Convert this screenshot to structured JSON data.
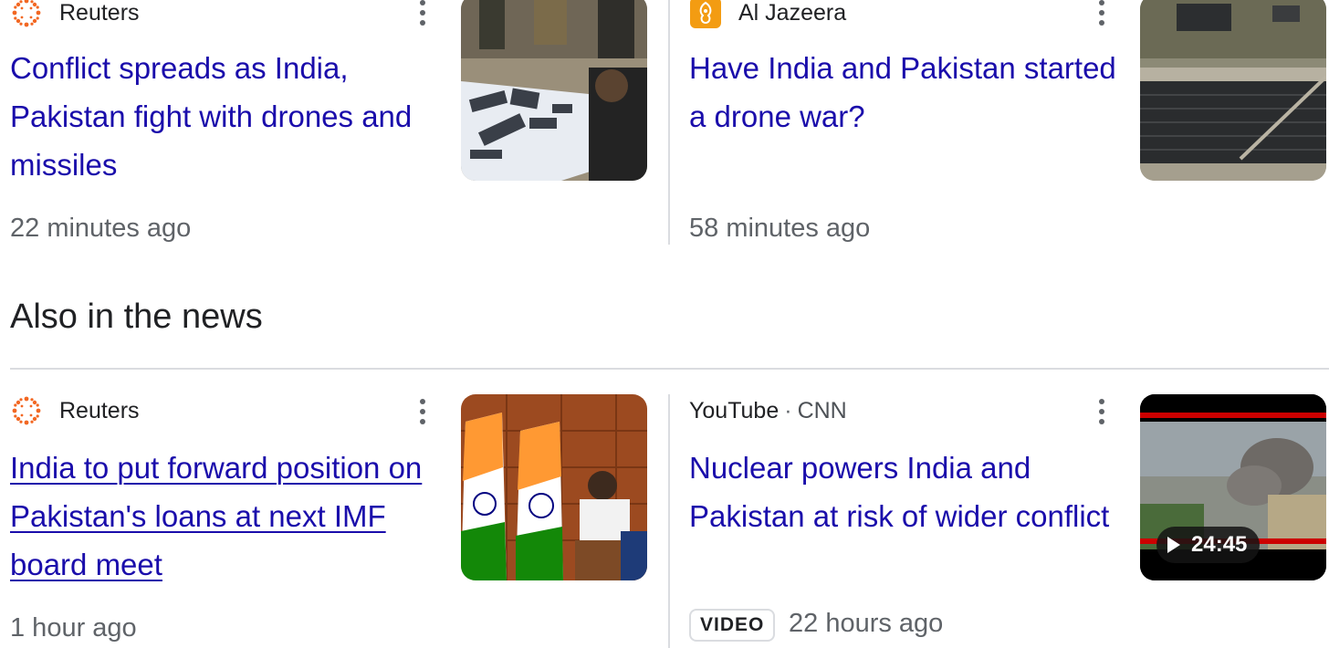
{
  "top_cards": [
    {
      "source": "Reuters",
      "icon": "reuters-logo-icon",
      "headline": "Conflict spreads as India, Pakistan fight with drones and missiles",
      "time": "22 minutes ago"
    },
    {
      "source": "Al Jazeera",
      "icon": "al-jazeera-logo-icon",
      "headline": "Have India and Pakistan started a drone war?",
      "time": "58 minutes ago"
    }
  ],
  "section": {
    "title": "Also in the news"
  },
  "bottom_cards": [
    {
      "source": "Reuters",
      "icon": "reuters-logo-icon",
      "headline": "India to put forward position on Pakistan's loans at next IMF board meet",
      "time": "1 hour ago"
    },
    {
      "source": "YouTube",
      "separator": "·",
      "source_sub": "CNN",
      "headline": "Nuclear powers India and Pakistan at risk of wider conflict",
      "badge": "VIDEO",
      "time": "22 hours ago",
      "duration": "24:45"
    }
  ],
  "colors": {
    "link": "#1a0dab",
    "meta": "#5f6368",
    "text": "#202124",
    "reuters_orange": "#f26722",
    "aljazeera_gold": "#f39c12",
    "divider": "#dadce0"
  }
}
